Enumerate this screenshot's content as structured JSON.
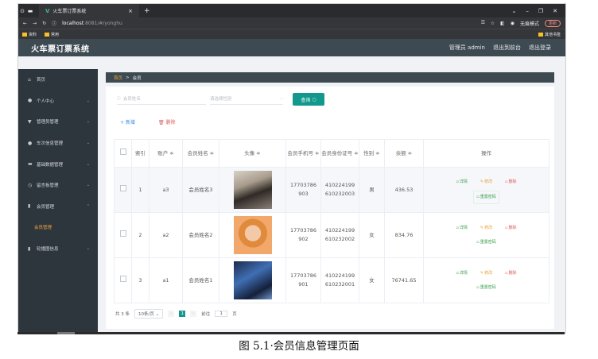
{
  "browser": {
    "tab_title": "火车票订票系统",
    "url_host": "localhost",
    "url_rest": ":8081/#/yonghu",
    "incognito_label": "无痕模式",
    "update_label": "更新",
    "bookmarks": [
      "资料",
      "常用"
    ],
    "other_bookmarks": "其他书签"
  },
  "app": {
    "title": "火车票订票系统",
    "user_label": "管理员 admin",
    "back_label": "退出到前台",
    "logout_label": "退出登录"
  },
  "sidebar": {
    "items": [
      {
        "label": "首页",
        "icon": "home-icon",
        "glyph": "⌂"
      },
      {
        "label": "个人中心",
        "icon": "user-icon",
        "glyph": "●"
      },
      {
        "label": "管理员管理",
        "icon": "shield-icon",
        "glyph": "▼"
      },
      {
        "label": "车次信息管理",
        "icon": "location-icon",
        "glyph": "●"
      },
      {
        "label": "基础数据管理",
        "icon": "server-icon",
        "glyph": "▬"
      },
      {
        "label": "留言板管理",
        "icon": "clock-icon",
        "glyph": "◷"
      },
      {
        "label": "会员管理",
        "icon": "chart-icon",
        "glyph": "▮"
      },
      {
        "label": "会员管理",
        "icon": "",
        "glyph": ""
      },
      {
        "label": "轮播图信息",
        "icon": "bar-chart-icon",
        "glyph": "▮"
      }
    ]
  },
  "breadcrumb": {
    "home": "首页",
    "separator": ">",
    "current": "会员"
  },
  "filters": {
    "name_placeholder": "会员姓名",
    "gender_placeholder": "请选择性别",
    "query_label": "查询"
  },
  "actions": {
    "add_label": "新增",
    "delete_label": "删除"
  },
  "table": {
    "headers": [
      "索引",
      "账户 ≑",
      "会员姓名 ≑",
      "头像 ≑",
      "会员手机号 ≑",
      "会员身份证号 ≑",
      "性别 ≑",
      "余额 ≑",
      "操作"
    ],
    "rows": [
      {
        "index": "1",
        "account": "a3",
        "name": "会员姓名3",
        "phone": "17703786903",
        "idcard": "410224199610232003",
        "gender": "男",
        "balance": "436.53"
      },
      {
        "index": "2",
        "account": "a2",
        "name": "会员姓名2",
        "phone": "17703786902",
        "idcard": "410224199610232002",
        "gender": "女",
        "balance": "834.76"
      },
      {
        "index": "3",
        "account": "a1",
        "name": "会员姓名1",
        "phone": "17703786901",
        "idcard": "410224199610232001",
        "gender": "女",
        "balance": "76741.65"
      }
    ],
    "ops": {
      "detail": "详情",
      "edit": "修改",
      "delete": "删除",
      "reset_password": "重置密码"
    }
  },
  "pager": {
    "total": "共 3 条",
    "page_size": "10条/页",
    "current_page": "1",
    "goto_label": "前往",
    "goto_value": "1",
    "page_suffix": "页"
  },
  "caption": "图 5.1·会员信息管理页面"
}
